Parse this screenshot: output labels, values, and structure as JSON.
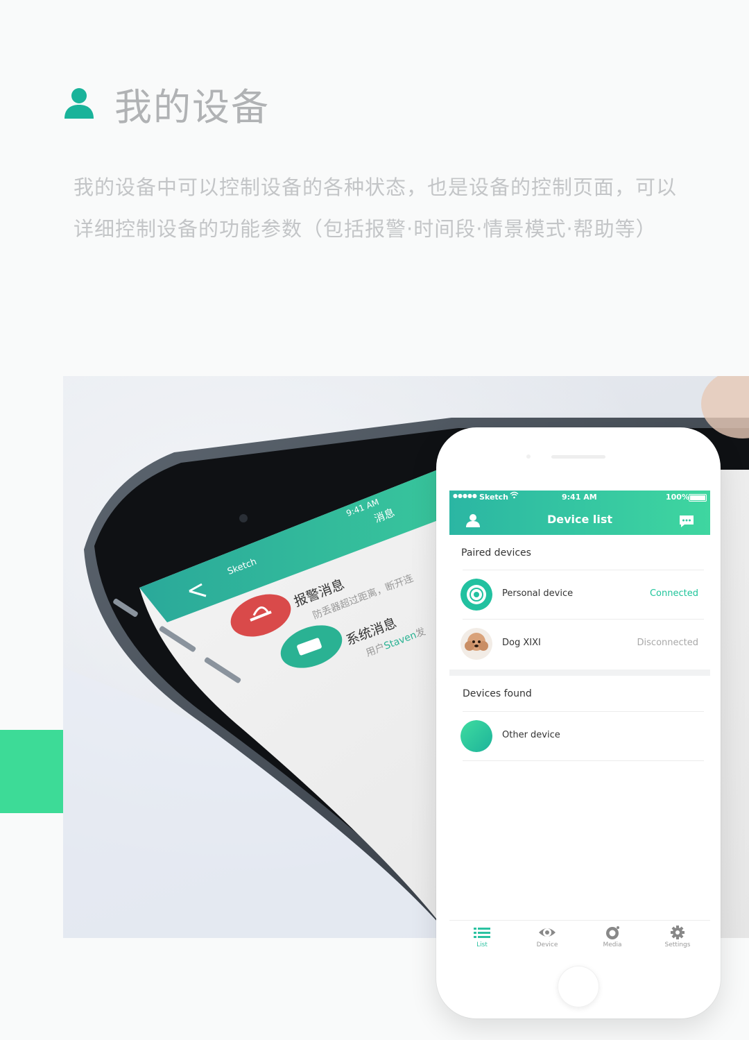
{
  "header": {
    "title": "我的设备",
    "icon": "user-icon",
    "accent_color": "#1ab39a",
    "description_line1": "我的设备中可以控制设备的各种状态，也是设备的控制页面，可以",
    "description_line2": "详细控制设备的功能参数（包括报警·时间段·情景模式·帮助等）"
  },
  "background_phone": {
    "status": {
      "carrier": "Sketch",
      "time": "9:41 AM"
    },
    "nav_title": "消息",
    "messages": [
      {
        "title": "报警消息",
        "subtitle": "防丢器超过距离，断开连",
        "icon": "alarm-icon",
        "color": "#d94a4a"
      },
      {
        "title": "系统消息",
        "subtitle_prefix": "用户",
        "subtitle_highlight": "Staven",
        "subtitle_suffix": "发",
        "icon": "chat-icon",
        "color": "#2ab293"
      }
    ]
  },
  "phone": {
    "status": {
      "carrier": "Sketch",
      "time": "9:41 AM",
      "battery": "100%"
    },
    "nav": {
      "title": "Device list",
      "left_icon": "user-icon",
      "right_icon": "chat-bubble-icon"
    },
    "paired_section": {
      "title": "Paired devices",
      "devices": [
        {
          "name": "Personal device",
          "status": "Connected",
          "icon": "device-icon"
        },
        {
          "name": "Dog XIXI",
          "status": "Disconnected",
          "icon": "dog-photo"
        }
      ]
    },
    "found_section": {
      "title": "Devices found",
      "devices": [
        {
          "name": "Other device",
          "icon": "green-circle"
        }
      ]
    },
    "tabs": [
      {
        "label": "List",
        "icon": "list-icon",
        "active": true
      },
      {
        "label": "Device",
        "icon": "eye-icon",
        "active": false
      },
      {
        "label": "Media",
        "icon": "media-icon",
        "active": false
      },
      {
        "label": "Settings",
        "icon": "gear-icon",
        "active": false
      }
    ]
  }
}
